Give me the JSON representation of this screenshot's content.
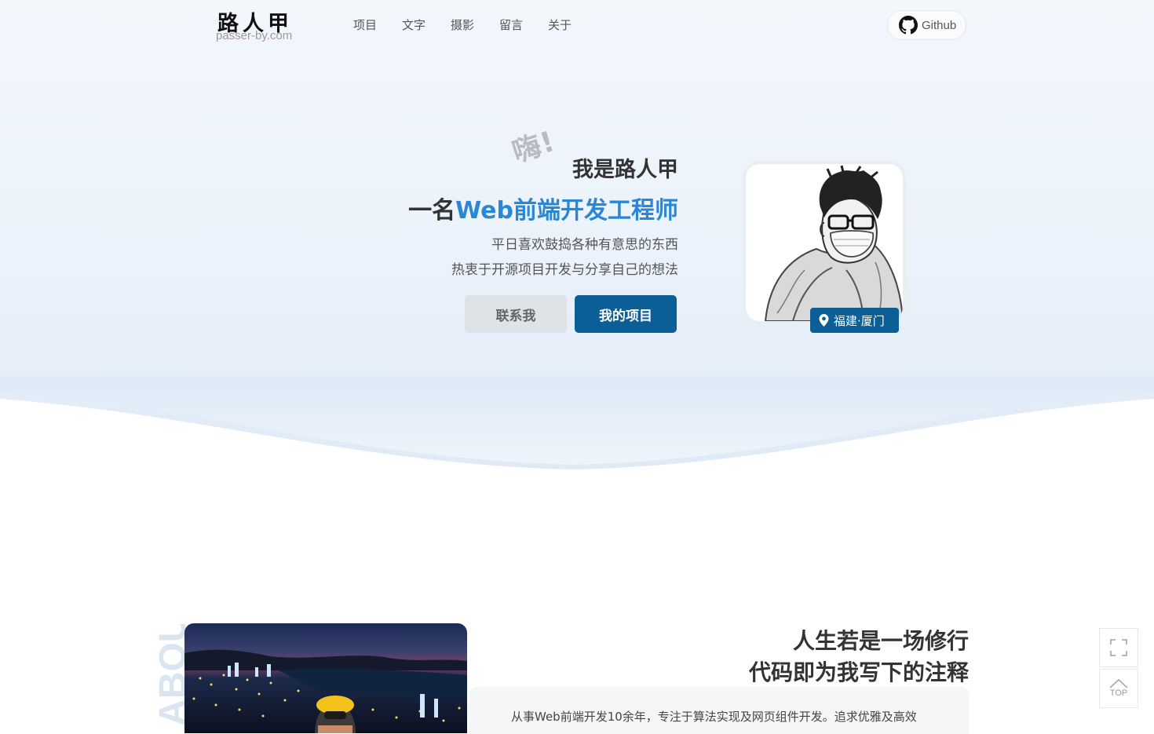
{
  "header": {
    "logo_title": "路人甲",
    "logo_domain": "passer-by.com",
    "nav": [
      {
        "label": "项目"
      },
      {
        "label": "文字"
      },
      {
        "label": "摄影"
      },
      {
        "label": "留言"
      },
      {
        "label": "关于"
      }
    ],
    "github_label": "Github"
  },
  "hero": {
    "greeting": "嗨!",
    "name_line": "我是路人甲",
    "role_prefix": "一名",
    "role_highlight": "Web前端开发工程师",
    "desc_line1": "平日喜欢鼓捣各种有意思的东西",
    "desc_line2": "热衷于开源项目开发与分享自己的想法",
    "contact_button": "联系我",
    "projects_button": "我的项目",
    "location": "福建·厦门"
  },
  "about": {
    "vertical_label": "ABOUT ME",
    "title_line1": "人生若是一场修行",
    "title_line2": "代码即为我写下的注释",
    "paragraph": "从事Web前端开发10余年，专注于算法实现及网页组件开发。追求优雅及高效"
  },
  "tools": {
    "fullscreen_icon": "fullscreen-icon",
    "top_label": "TOP"
  },
  "colors": {
    "accent": "#2a87d6",
    "primary_button": "#0c5f96",
    "secondary_button": "#dfe3e8"
  }
}
